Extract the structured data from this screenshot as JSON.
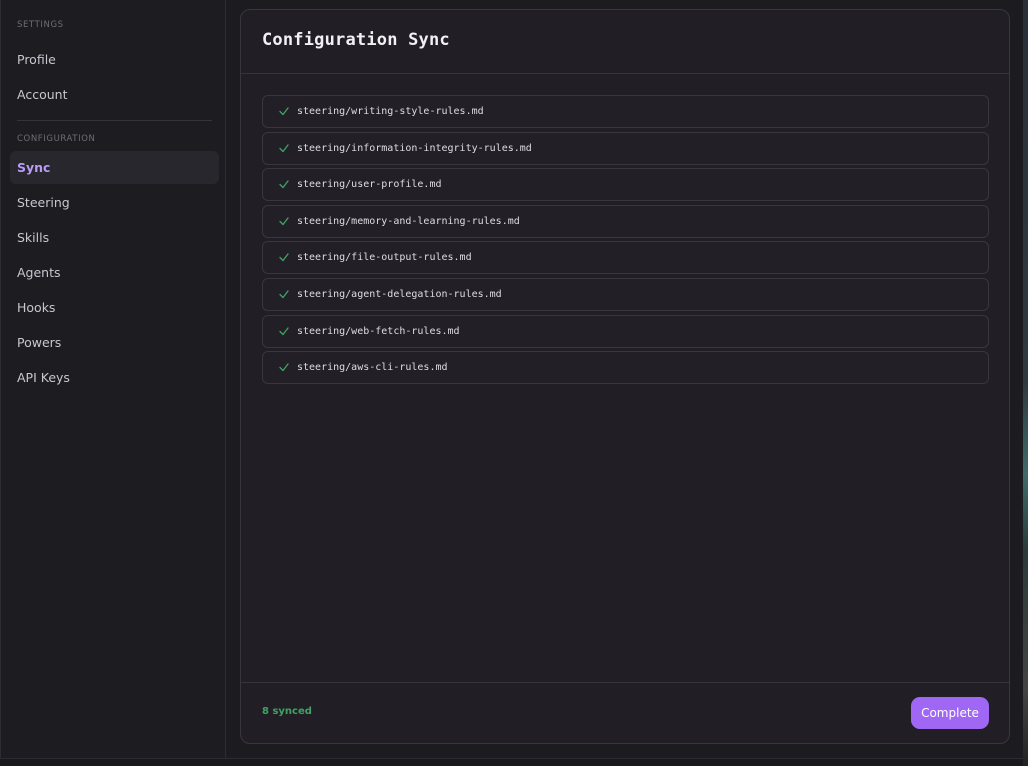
{
  "sidebar": {
    "settings_label": "SETTINGS",
    "settings_items": [
      "Profile",
      "Account"
    ],
    "configuration_label": "CONFIGURATION",
    "configuration_items": [
      "Sync",
      "Steering",
      "Skills",
      "Agents",
      "Hooks",
      "Powers",
      "API Keys"
    ],
    "active_item": "Sync"
  },
  "panel": {
    "title": "Configuration Sync",
    "files": [
      "steering/writing-style-rules.md",
      "steering/information-integrity-rules.md",
      "steering/user-profile.md",
      "steering/memory-and-learning-rules.md",
      "steering/file-output-rules.md",
      "steering/agent-delegation-rules.md",
      "steering/web-fetch-rules.md",
      "steering/aws-cli-rules.md"
    ],
    "status": "8 synced",
    "complete_label": "Complete"
  },
  "colors": {
    "accent": "#a067f5",
    "active_text": "#b99cf6",
    "success": "#3fa463"
  },
  "icons": {
    "file_status": "check-icon"
  }
}
